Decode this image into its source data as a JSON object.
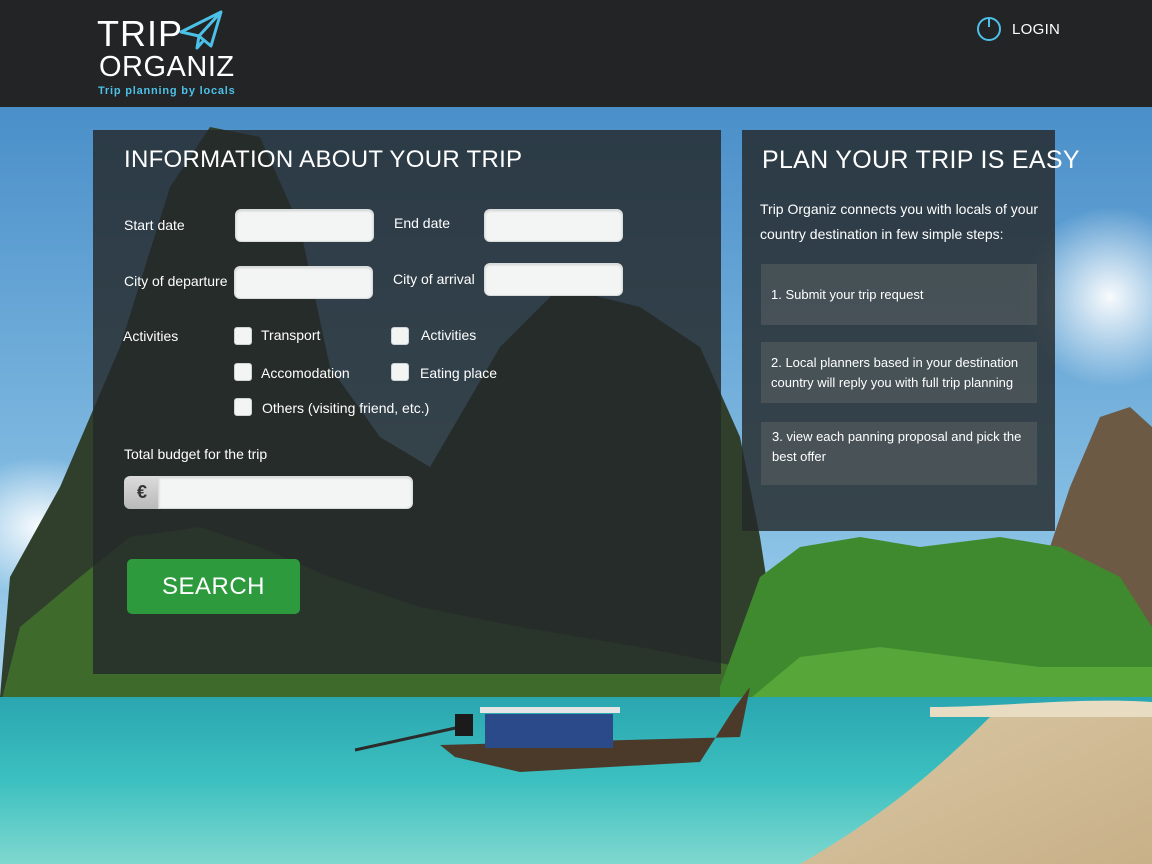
{
  "header": {
    "logo_line1": "TRIP",
    "logo_line2": "ORGANIZ",
    "tagline": "Trip planning by locals",
    "login_label": "LOGIN"
  },
  "form": {
    "title": "INFORMATION ABOUT YOUR TRIP",
    "start_date_label": "Start date",
    "start_date_value": "",
    "end_date_label": "End date",
    "end_date_value": "",
    "city_departure_label": "City of departure",
    "city_departure_value": "",
    "city_arrival_label": "City of arrival",
    "city_arrival_value": "",
    "activities_label": "Activities",
    "checkboxes": [
      {
        "label": "Transport",
        "checked": false
      },
      {
        "label": "Activities",
        "checked": false
      },
      {
        "label": "Accomodation",
        "checked": false
      },
      {
        "label": "Eating place",
        "checked": false
      },
      {
        "label": "Others (visiting friend, etc.)",
        "checked": false
      }
    ],
    "budget_label": "Total budget for the trip",
    "currency_symbol": "€",
    "budget_value": "",
    "search_label": "SEARCH"
  },
  "info": {
    "title": "PLAN YOUR TRIP IS EASY",
    "intro": "Trip Organiz connects you with locals of your country destination in few simple steps:",
    "steps": [
      "1. Submit your trip request",
      "2. Local planners based in your destination country will reply you with full trip planning",
      "3.  view each panning proposal and pick the best offer"
    ]
  },
  "colors": {
    "header_bg": "#232425",
    "accent": "#4cc1e8",
    "search_button": "#2c9a3d"
  }
}
